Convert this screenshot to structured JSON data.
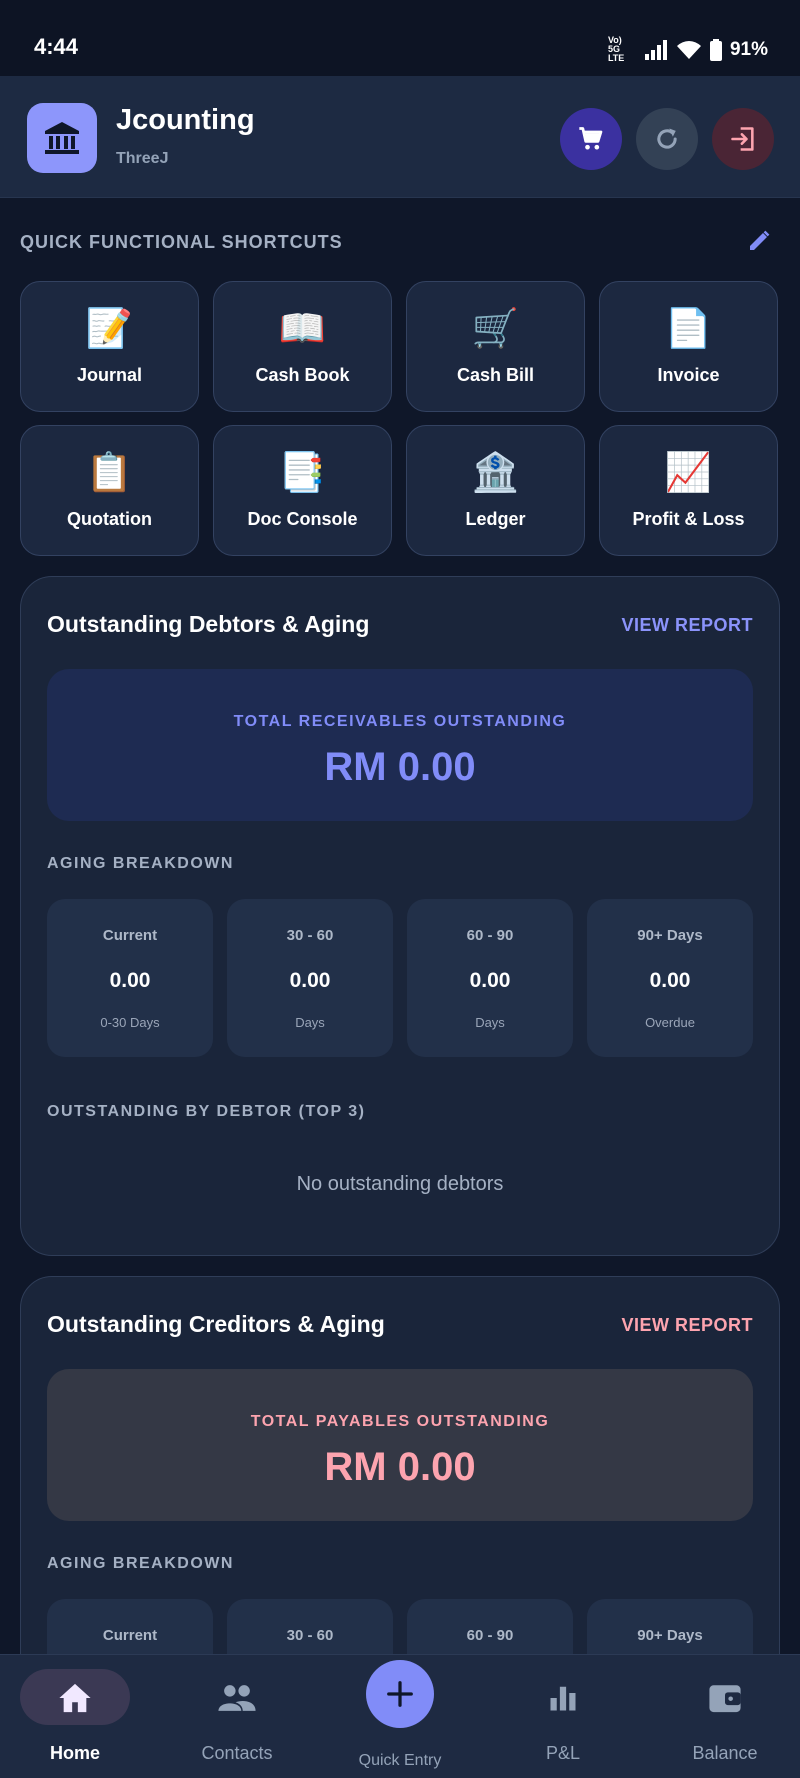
{
  "status": {
    "time": "4:44",
    "network": "Vo) 5G LTE",
    "battery": "91%"
  },
  "header": {
    "title": "Jcounting",
    "subtitle": "ThreeJ",
    "icons": [
      "bank-icon",
      "cart-icon",
      "refresh-icon",
      "logout-icon"
    ]
  },
  "shortcuts": {
    "title": "QUICK FUNCTIONAL SHORTCUTS",
    "items": [
      {
        "label": "Journal",
        "icon": "📝"
      },
      {
        "label": "Cash Book",
        "icon": "📖"
      },
      {
        "label": "Cash Bill",
        "icon": "🛒"
      },
      {
        "label": "Invoice",
        "icon": "📄"
      },
      {
        "label": "Quotation",
        "icon": "📋"
      },
      {
        "label": "Doc Console",
        "icon": "📑"
      },
      {
        "label": "Ledger",
        "icon": "🏦"
      },
      {
        "label": "Profit & Loss",
        "icon": "📈"
      }
    ]
  },
  "debtors": {
    "title": "Outstanding Debtors & Aging",
    "link": "VIEW REPORT",
    "total_label": "TOTAL RECEIVABLES OUTSTANDING",
    "total_value": "RM 0.00",
    "aging_title": "AGING BREAKDOWN",
    "aging": [
      {
        "label": "Current",
        "value": "0.00",
        "note": "0-30 Days"
      },
      {
        "label": "30 - 60",
        "value": "0.00",
        "note": "Days"
      },
      {
        "label": "60 - 90",
        "value": "0.00",
        "note": "Days"
      },
      {
        "label": "90+ Days",
        "value": "0.00",
        "note": "Overdue"
      }
    ],
    "top_title": "OUTSTANDING BY DEBTOR (TOP 3)",
    "empty": "No outstanding debtors"
  },
  "creditors": {
    "title": "Outstanding Creditors & Aging",
    "link": "VIEW REPORT",
    "total_label": "TOTAL PAYABLES OUTSTANDING",
    "total_value": "RM 0.00",
    "aging_title": "AGING BREAKDOWN",
    "aging": [
      {
        "label": "Current"
      },
      {
        "label": "30 - 60"
      },
      {
        "label": "60 - 90"
      },
      {
        "label": "90+ Days"
      }
    ]
  },
  "nav": {
    "home": "Home",
    "contacts": "Contacts",
    "quick_entry": "Quick Entry",
    "pl": "P&L",
    "balance": "Balance"
  },
  "colors": {
    "accent": "#818cf8",
    "accent_pink": "#fda4af",
    "background": "#0f1729",
    "card": "#1a253a"
  }
}
